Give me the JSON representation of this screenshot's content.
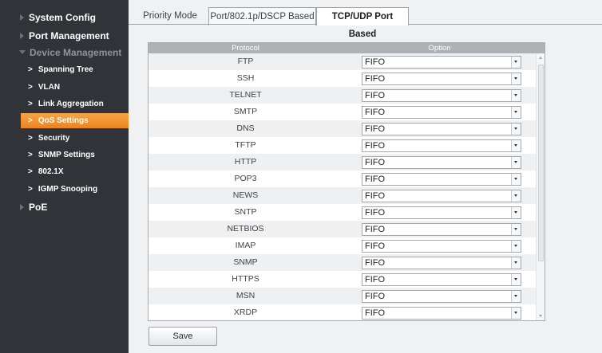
{
  "sidebar": {
    "sections": [
      {
        "label": "System Config"
      },
      {
        "label": "Port Management"
      },
      {
        "label": "Device Management"
      },
      {
        "label": "PoE"
      }
    ],
    "submenu": [
      {
        "label": "Spanning Tree"
      },
      {
        "label": "VLAN"
      },
      {
        "label": "Link Aggregation"
      },
      {
        "label": "QoS Settings"
      },
      {
        "label": "Security"
      },
      {
        "label": "SNMP Settings"
      },
      {
        "label": "802.1X"
      },
      {
        "label": "IGMP Snooping"
      }
    ],
    "submenu_chevron": ">",
    "active_item": "QoS Settings",
    "accent_color": "#f39a3a"
  },
  "tabs": [
    {
      "label": "Priority Mode"
    },
    {
      "label": "Port/802.1p/DSCP Based"
    },
    {
      "label": "TCP/UDP Port Based"
    }
  ],
  "active_tab": "TCP/UDP Port Based",
  "table": {
    "headers": {
      "protocol": "Protocol",
      "option": "Option"
    },
    "rows": [
      {
        "protocol": "FTP",
        "option": "FIFO"
      },
      {
        "protocol": "SSH",
        "option": "FIFO"
      },
      {
        "protocol": "TELNET",
        "option": "FIFO"
      },
      {
        "protocol": "SMTP",
        "option": "FIFO"
      },
      {
        "protocol": "DNS",
        "option": "FIFO"
      },
      {
        "protocol": "TFTP",
        "option": "FIFO"
      },
      {
        "protocol": "HTTP",
        "option": "FIFO"
      },
      {
        "protocol": "POP3",
        "option": "FIFO"
      },
      {
        "protocol": "NEWS",
        "option": "FIFO"
      },
      {
        "protocol": "SNTP",
        "option": "FIFO"
      },
      {
        "protocol": "NETBIOS",
        "option": "FIFO"
      },
      {
        "protocol": "IMAP",
        "option": "FIFO"
      },
      {
        "protocol": "SNMP",
        "option": "FIFO"
      },
      {
        "protocol": "HTTPS",
        "option": "FIFO"
      },
      {
        "protocol": "MSN",
        "option": "FIFO"
      },
      {
        "protocol": "XRDP",
        "option": "FIFO"
      }
    ]
  },
  "save_label": "Save"
}
